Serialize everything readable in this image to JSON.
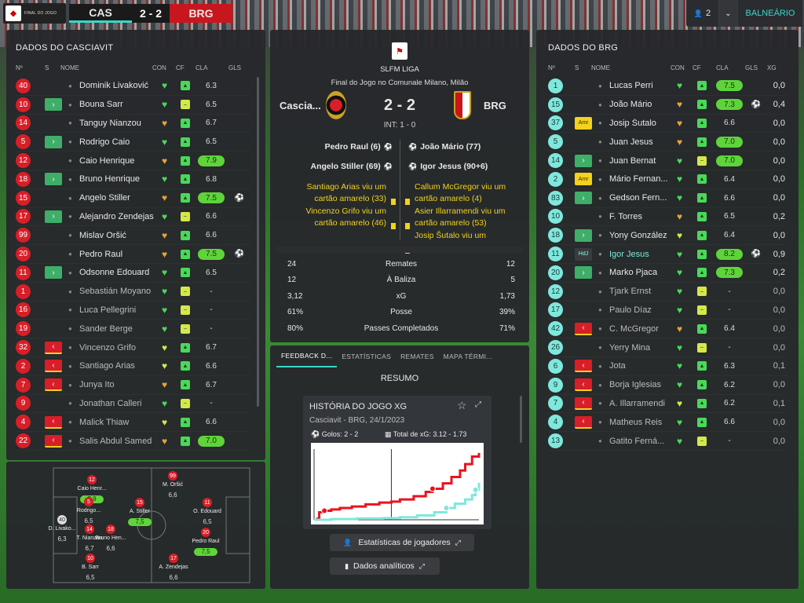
{
  "topbar": {
    "logo_text": "FINAL DO JOGO",
    "home_abbr": "CAS",
    "score": "2 - 2",
    "away_abbr": "BRG",
    "users_count": "2",
    "room_button": "BALNEÁRIO"
  },
  "home_panel": {
    "title": "DADOS DO CASCIAVIT",
    "columns": {
      "num": "Nº",
      "s": "S",
      "name": "NOME",
      "con": "CON",
      "cf": "CF",
      "cla": "CLA",
      "gls": "GLS"
    },
    "players": [
      {
        "num": "40",
        "sub": "",
        "name": "Dominik Livaković",
        "heart": "green",
        "cf": "green",
        "cla": "6.3",
        "hi": false,
        "goal": false,
        "dim": false
      },
      {
        "num": "10",
        "sub": "in",
        "name": "Bouna Sarr",
        "heart": "green",
        "cf": "yellow",
        "cla": "6.5",
        "hi": false,
        "goal": false,
        "dim": false
      },
      {
        "num": "14",
        "sub": "",
        "name": "Tanguy Nianzou",
        "heart": "orange",
        "cf": "green",
        "cla": "6.7",
        "hi": false,
        "goal": false,
        "dim": false
      },
      {
        "num": "5",
        "sub": "in",
        "name": "Rodrigo Caio",
        "heart": "green",
        "cf": "green",
        "cla": "6.5",
        "hi": false,
        "goal": false,
        "dim": false
      },
      {
        "num": "12",
        "sub": "",
        "name": "Caio Henrique",
        "heart": "orange",
        "cf": "green",
        "cla": "7.9",
        "hi": true,
        "goal": false,
        "dim": false
      },
      {
        "num": "18",
        "sub": "in",
        "name": "Bruno Henrique",
        "heart": "green",
        "cf": "green",
        "cla": "6.8",
        "hi": false,
        "goal": false,
        "dim": false
      },
      {
        "num": "15",
        "sub": "",
        "name": "Angelo Stiller",
        "heart": "orange",
        "cf": "green",
        "cla": "7.5",
        "hi": true,
        "goal": true,
        "dim": false
      },
      {
        "num": "17",
        "sub": "in",
        "name": "Alejandro Zendejas",
        "heart": "green",
        "cf": "yellow",
        "cla": "6.6",
        "hi": false,
        "goal": false,
        "dim": false
      },
      {
        "num": "99",
        "sub": "",
        "name": "Mislav Oršić",
        "heart": "orange",
        "cf": "green",
        "cla": "6.6",
        "hi": false,
        "goal": false,
        "dim": false
      },
      {
        "num": "20",
        "sub": "",
        "name": "Pedro Raul",
        "heart": "orange",
        "cf": "green",
        "cla": "7.5",
        "hi": true,
        "goal": true,
        "dim": false
      },
      {
        "num": "11",
        "sub": "in",
        "name": "Odsonne Edouard",
        "heart": "green",
        "cf": "green",
        "cla": "6.5",
        "hi": false,
        "goal": false,
        "dim": false
      },
      {
        "num": "1",
        "sub": "",
        "name": "Sebastián Moyano",
        "heart": "green",
        "cf": "yellow",
        "cla": "-",
        "hi": false,
        "goal": false,
        "dim": true
      },
      {
        "num": "16",
        "sub": "",
        "name": "Luca Pellegrini",
        "heart": "green",
        "cf": "yellow",
        "cla": "-",
        "hi": false,
        "goal": false,
        "dim": true
      },
      {
        "num": "19",
        "sub": "",
        "name": "Sander Berge",
        "heart": "green",
        "cf": "yellow",
        "cla": "-",
        "hi": false,
        "goal": false,
        "dim": true
      },
      {
        "num": "32",
        "sub": "out",
        "name": "Vincenzo Grifo",
        "heart": "yellow",
        "cf": "green",
        "cla": "6.7",
        "hi": false,
        "goal": false,
        "dim": true
      },
      {
        "num": "2",
        "sub": "out",
        "name": "Santiago Arias",
        "heart": "yellow",
        "cf": "green",
        "cla": "6.6",
        "hi": false,
        "goal": false,
        "dim": true
      },
      {
        "num": "7",
        "sub": "out",
        "name": "Junya Ito",
        "heart": "orange",
        "cf": "green",
        "cla": "6.7",
        "hi": false,
        "goal": false,
        "dim": true
      },
      {
        "num": "9",
        "sub": "",
        "name": "Jonathan Calleri",
        "heart": "green",
        "cf": "yellow",
        "cla": "-",
        "hi": false,
        "goal": false,
        "dim": true
      },
      {
        "num": "4",
        "sub": "out",
        "name": "Malick Thiaw",
        "heart": "yellow",
        "cf": "green",
        "cla": "6.6",
        "hi": false,
        "goal": false,
        "dim": true
      },
      {
        "num": "22",
        "sub": "out",
        "name": "Salis Abdul Samed",
        "heart": "orange",
        "cf": "green",
        "cla": "7.0",
        "hi": true,
        "goal": false,
        "dim": true
      }
    ]
  },
  "formation": {
    "players": [
      {
        "num": "40",
        "label": "D. Livako...",
        "val": "6,3",
        "hi": false,
        "gk": true
      },
      {
        "num": "12",
        "label": "Caio Henr...",
        "val": "7,9",
        "hi": true,
        "gk": false
      },
      {
        "num": "5",
        "label": "Rodrigo...",
        "val": "6,5",
        "hi": false,
        "gk": false
      },
      {
        "num": "14",
        "label": "T. Nianzou",
        "val": "6,7",
        "hi": false,
        "gk": false
      },
      {
        "num": "18",
        "label": "Bruno Hen...",
        "val": "6,6",
        "hi": false,
        "gk": false
      },
      {
        "num": "10",
        "label": "B. Sarr",
        "val": "6,5",
        "hi": false,
        "gk": false
      },
      {
        "num": "15",
        "label": "A. Stiller",
        "val": "7,5",
        "hi": true,
        "gk": false
      },
      {
        "num": "99",
        "label": "M. Oršić",
        "val": "6,6",
        "hi": false,
        "gk": false
      },
      {
        "num": "17",
        "label": "A. Zendejas",
        "val": "6,6",
        "hi": false,
        "gk": false
      },
      {
        "num": "11",
        "label": "O. Edouard",
        "val": "6,5",
        "hi": false,
        "gk": false
      },
      {
        "num": "20",
        "label": "Pedro Raul",
        "val": "7,5",
        "hi": true,
        "gk": false
      }
    ]
  },
  "match": {
    "league": "SLFM LIGA",
    "subtitle": "Final do Jogo no Comunale Milano, Milão",
    "home_name": "Cascia...",
    "score": "2 - 2",
    "away_name": "BRG",
    "halftime": "INT: 1 - 0",
    "home_goals": [
      "Pedro Raul (6)",
      "Angelo Stiller (69)"
    ],
    "away_goals": [
      "João Mário (77)",
      "Igor Jesus (90+6)"
    ],
    "home_cards": [
      "Santiago Arias viu um cartão amarelo (33)",
      "Vincenzo Grifo viu um cartão amarelo (46)"
    ],
    "away_cards": [
      "Callum McGregor viu um cartão amarelo (4)",
      "Asier Illarramendi viu um cartão amarelo (53)",
      "Josip Šutalo viu um"
    ],
    "stats": [
      {
        "h": "24",
        "label": "Remates",
        "a": "12"
      },
      {
        "h": "12",
        "label": "À Baliza",
        "a": "5"
      },
      {
        "h": "3,12",
        "label": "xG",
        "a": "1,73"
      },
      {
        "h": "61%",
        "label": "Posse",
        "a": "39%"
      },
      {
        "h": "80%",
        "label": "Passes Completados",
        "a": "71%"
      }
    ]
  },
  "tabs": [
    "FEEDBACK D...",
    "ESTATÍSTICAS",
    "REMATES",
    "MAPA TÉRMI..."
  ],
  "summary": {
    "title": "RESUMO",
    "card_title": "HISTÓRIA DO JOGO XG",
    "card_sub": "Casciavit - BRG, 24/1/2023",
    "goals_label": "Golos: 2 - 2",
    "xg_label": "Total de xG: 3.12 - 1.73",
    "btn_players": "Estatísticas de jogadores",
    "btn_analytics": "Dados analíticos"
  },
  "chart_data": {
    "type": "line",
    "title": "HISTÓRIA DO JOGO XG",
    "xlabel": "",
    "ylabel": "",
    "x_halftime": 45,
    "series": [
      {
        "name": "Casciavit",
        "color": "#e8141e",
        "points": [
          [
            0,
            0
          ],
          [
            2,
            0.05
          ],
          [
            3,
            0.35
          ],
          [
            6,
            0.42
          ],
          [
            10,
            0.48
          ],
          [
            15,
            0.55
          ],
          [
            22,
            0.62
          ],
          [
            30,
            0.72
          ],
          [
            38,
            0.8
          ],
          [
            45,
            0.85
          ],
          [
            50,
            0.95
          ],
          [
            58,
            1.1
          ],
          [
            65,
            1.3
          ],
          [
            69,
            1.45
          ],
          [
            75,
            1.7
          ],
          [
            80,
            2.0
          ],
          [
            85,
            2.3
          ],
          [
            88,
            2.6
          ],
          [
            92,
            2.95
          ],
          [
            96,
            3.12
          ]
        ],
        "goals": [
          6,
          69
        ]
      },
      {
        "name": "BRG",
        "color": "#7fe8dc",
        "points": [
          [
            0,
            0
          ],
          [
            10,
            0.03
          ],
          [
            25,
            0.06
          ],
          [
            40,
            0.08
          ],
          [
            50,
            0.12
          ],
          [
            60,
            0.2
          ],
          [
            70,
            0.35
          ],
          [
            77,
            0.55
          ],
          [
            82,
            0.75
          ],
          [
            88,
            0.95
          ],
          [
            92,
            1.15
          ],
          [
            94,
            1.4
          ],
          [
            96,
            1.73
          ]
        ],
        "goals": [
          77,
          94
        ]
      }
    ]
  },
  "away_panel": {
    "title": "DADOS DO BRG",
    "columns": {
      "num": "Nº",
      "s": "S",
      "name": "NOME",
      "con": "CON",
      "cf": "CF",
      "cla": "CLA",
      "gls": "GLS",
      "xg": "XG"
    },
    "players": [
      {
        "num": "1",
        "sub": "",
        "name": "Lucas Perri",
        "heart": "green",
        "cf": "green",
        "cla": "7.5",
        "hi": true,
        "goal": false,
        "xg": "0,0",
        "dim": false
      },
      {
        "num": "15",
        "sub": "",
        "name": "João Mário",
        "heart": "orange",
        "cf": "green",
        "cla": "7.3",
        "hi": true,
        "goal": true,
        "xg": "0,4",
        "dim": false
      },
      {
        "num": "37",
        "sub": "amr",
        "name": "Josip Šutalo",
        "heart": "orange",
        "cf": "green",
        "cla": "6.6",
        "hi": false,
        "goal": false,
        "xg": "0,0",
        "dim": false
      },
      {
        "num": "5",
        "sub": "",
        "name": "Juan Jesus",
        "heart": "orange",
        "cf": "green",
        "cla": "7.0",
        "hi": true,
        "goal": false,
        "xg": "0,0",
        "dim": false
      },
      {
        "num": "14",
        "sub": "in",
        "name": "Juan Bernat",
        "heart": "green",
        "cf": "yellow",
        "cla": "7.0",
        "hi": true,
        "goal": false,
        "xg": "0,0",
        "dim": false
      },
      {
        "num": "2",
        "sub": "amr",
        "name": "Mário Fernan...",
        "heart": "green",
        "cf": "green",
        "cla": "6.4",
        "hi": false,
        "goal": false,
        "xg": "0,0",
        "dim": false
      },
      {
        "num": "83",
        "sub": "in",
        "name": "Gedson Fern...",
        "heart": "green",
        "cf": "green",
        "cla": "6.6",
        "hi": false,
        "goal": false,
        "xg": "0,0",
        "dim": false
      },
      {
        "num": "10",
        "sub": "",
        "name": "F. Torres",
        "heart": "orange",
        "cf": "green",
        "cla": "6.5",
        "hi": false,
        "goal": false,
        "xg": "0,2",
        "dim": false
      },
      {
        "num": "18",
        "sub": "in",
        "name": "Yony González",
        "heart": "yellow",
        "cf": "green",
        "cla": "6.4",
        "hi": false,
        "goal": false,
        "xg": "0,0",
        "dim": false
      },
      {
        "num": "11",
        "sub": "hdj",
        "name": "Igor Jesus",
        "heart": "green",
        "cf": "green",
        "cla": "8.2",
        "hi": true,
        "goal": true,
        "xg": "0,9",
        "dim": false,
        "highlight": true
      },
      {
        "num": "20",
        "sub": "in",
        "name": "Marko Pjaca",
        "heart": "green",
        "cf": "green",
        "cla": "7.3",
        "hi": true,
        "goal": false,
        "xg": "0,2",
        "dim": false
      },
      {
        "num": "12",
        "sub": "",
        "name": "Tjark Ernst",
        "heart": "green",
        "cf": "yellow",
        "cla": "-",
        "hi": false,
        "goal": false,
        "xg": "0,0",
        "dim": true
      },
      {
        "num": "17",
        "sub": "",
        "name": "Paulo Díaz",
        "heart": "green",
        "cf": "yellow",
        "cla": "-",
        "hi": false,
        "goal": false,
        "xg": "0,0",
        "dim": true
      },
      {
        "num": "42",
        "sub": "out",
        "name": "C. McGregor",
        "heart": "orange",
        "cf": "green",
        "cla": "6.4",
        "hi": false,
        "goal": false,
        "xg": "0,0",
        "dim": true
      },
      {
        "num": "26",
        "sub": "",
        "name": "Yerry Mina",
        "heart": "green",
        "cf": "yellow",
        "cla": "-",
        "hi": false,
        "goal": false,
        "xg": "0,0",
        "dim": true
      },
      {
        "num": "6",
        "sub": "out",
        "name": "Jota",
        "heart": "green",
        "cf": "green",
        "cla": "6.3",
        "hi": false,
        "goal": false,
        "xg": "0,1",
        "dim": true
      },
      {
        "num": "9",
        "sub": "out",
        "name": "Borja Iglesias",
        "heart": "green",
        "cf": "green",
        "cla": "6.2",
        "hi": false,
        "goal": false,
        "xg": "0,0",
        "dim": true
      },
      {
        "num": "7",
        "sub": "out",
        "name": "A. Illarramendi",
        "heart": "yellow",
        "cf": "green",
        "cla": "6.2",
        "hi": false,
        "goal": false,
        "xg": "0,1",
        "dim": true
      },
      {
        "num": "4",
        "sub": "out",
        "name": "Matheus Reis",
        "heart": "green",
        "cf": "green",
        "cla": "6.6",
        "hi": false,
        "goal": false,
        "xg": "0,0",
        "dim": true
      },
      {
        "num": "13",
        "sub": "",
        "name": "Gatito Ferná...",
        "heart": "green",
        "cf": "yellow",
        "cla": "-",
        "hi": false,
        "goal": false,
        "xg": "0,0",
        "dim": true
      }
    ]
  },
  "colors": {
    "accent": "#3bd6c6",
    "home": "#d81e28",
    "away": "#7fe8dc",
    "rating_high": "#5ed43a"
  }
}
